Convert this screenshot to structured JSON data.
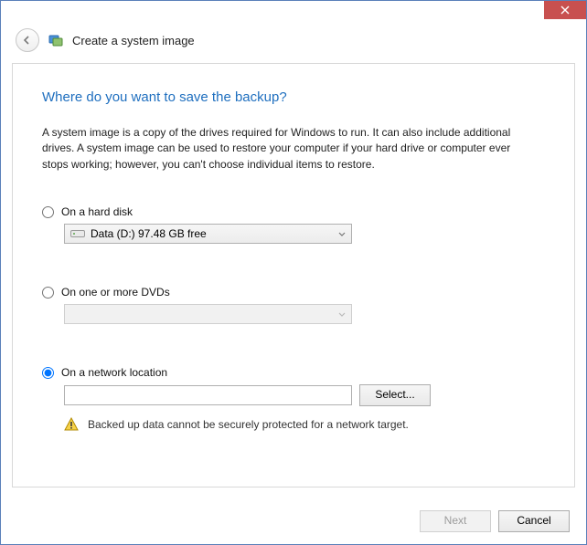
{
  "window": {
    "title": "Create a system image"
  },
  "page": {
    "heading": "Where do you want to save the backup?",
    "description": "A system image is a copy of the drives required for Windows to run. It can also include additional drives. A system image can be used to restore your computer if your hard drive or computer ever stops working; however, you can't choose individual items to restore."
  },
  "options": {
    "hard_disk": {
      "label": "On a hard disk",
      "selected": false,
      "drive_display": "Data (D:)  97.48 GB free"
    },
    "dvd": {
      "label": "On one or more DVDs",
      "selected": false,
      "drive_display": ""
    },
    "network": {
      "label": "On a network location",
      "selected": true,
      "path": "",
      "select_button": "Select...",
      "warning": "Backed up data cannot be securely protected for a network target."
    }
  },
  "footer": {
    "next": "Next",
    "cancel": "Cancel",
    "next_enabled": false
  }
}
